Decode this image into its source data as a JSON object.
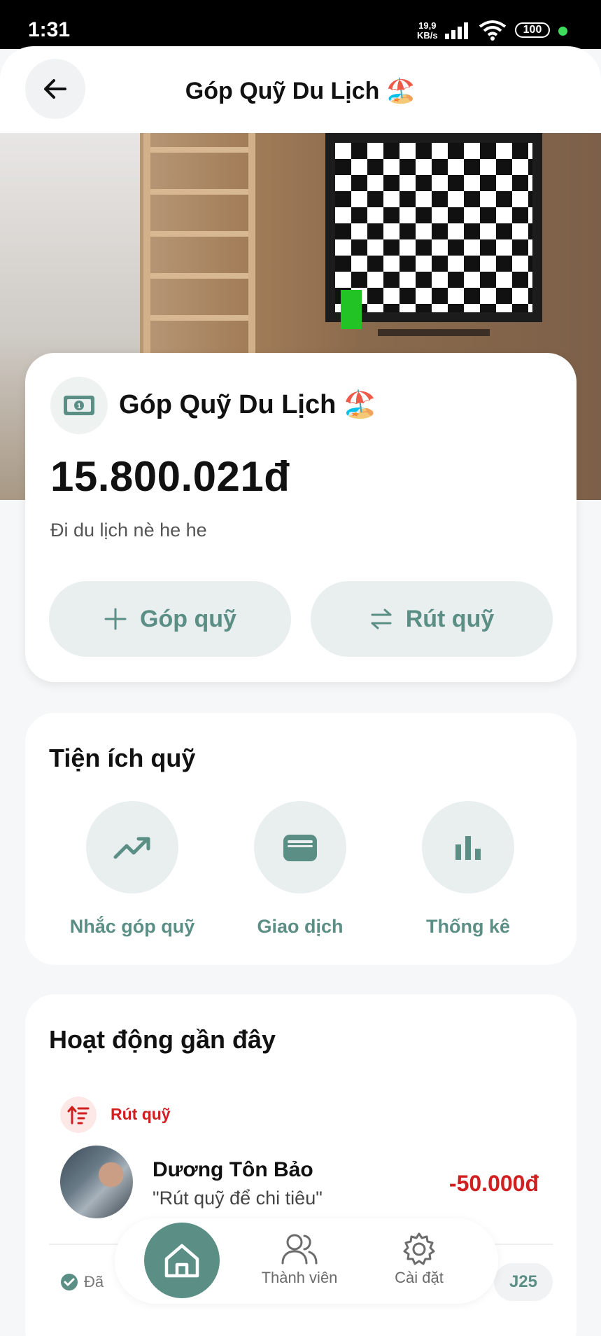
{
  "status_bar": {
    "time": "1:31",
    "net_speed_value": "19,9",
    "net_speed_unit": "KB/s",
    "battery": "100"
  },
  "header": {
    "title": "Góp Quỹ Du Lịch 🏖️"
  },
  "fund": {
    "name": "Góp Quỹ Du Lịch 🏖️",
    "amount": "15.800.021đ",
    "description": "Đi du lịch nè he he",
    "contribute_label": "Góp quỹ",
    "withdraw_label": "Rút quỹ"
  },
  "utilities": {
    "title": "Tiện ích quỹ",
    "items": [
      {
        "label": "Nhắc góp quỹ",
        "icon": "trending-up-icon"
      },
      {
        "label": "Giao dịch",
        "icon": "wallet-icon"
      },
      {
        "label": "Thống kê",
        "icon": "bar-chart-icon"
      }
    ]
  },
  "activity": {
    "title": "Hoạt động gần đây",
    "items": [
      {
        "type": "Rút quỹ",
        "name": "Dương Tôn Bảo",
        "note": "\"Rút quỹ để chi tiêu\"",
        "amount": "-50.000đ",
        "status": "Đã",
        "chip": "J25"
      }
    ]
  },
  "bottom_nav": {
    "members_label": "Thành viên",
    "settings_label": "Cài đặt"
  },
  "colors": {
    "accent": "#5b8f86",
    "accent_light": "#e9eeee",
    "negative": "#cf1f1f"
  }
}
